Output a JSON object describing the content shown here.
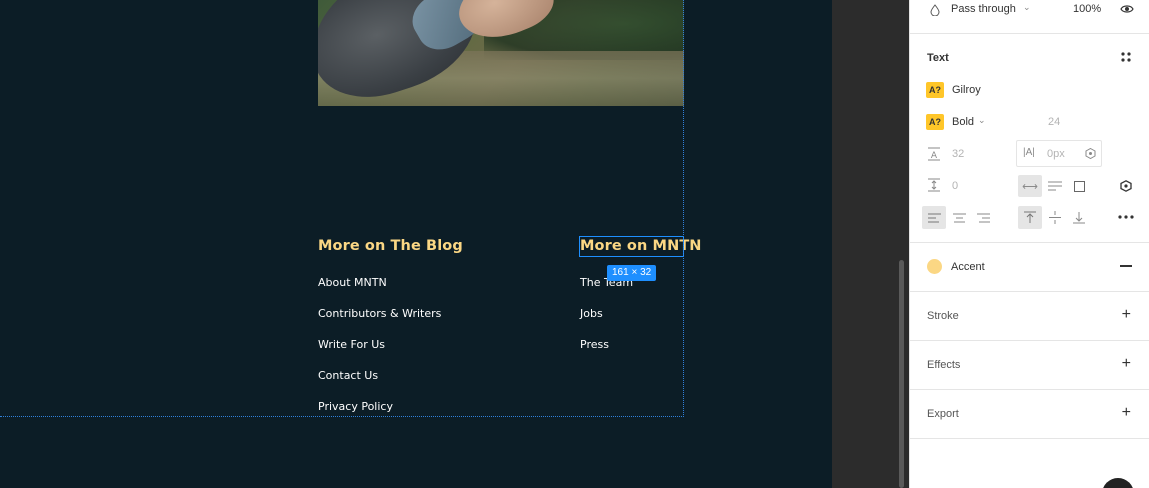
{
  "canvas": {
    "selection_size": "161 × 32",
    "blog_column": {
      "title": "More on The Blog",
      "links": [
        "About MNTN",
        "Contributors & Writers",
        "Write For Us",
        "Contact Us",
        "Privacy Policy"
      ]
    },
    "mntn_column": {
      "title": "More on MNTN",
      "links": [
        "The Team",
        "Jobs",
        "Press"
      ]
    },
    "colors": {
      "background": "#0c1d26",
      "accent": "#fbd784",
      "selection": "#1e8fff"
    }
  },
  "inspector": {
    "layer": {
      "blend_mode": "Pass through",
      "opacity": "100%"
    },
    "text": {
      "section_title": "Text",
      "font_family": "Gilroy",
      "font_weight": "Bold",
      "font_size": "24",
      "line_height": "32",
      "letter_spacing": "0px",
      "paragraph_spacing": "0",
      "style_chip": "A?"
    },
    "fill": {
      "style_name": "Accent",
      "color": "#fbd784"
    },
    "sections": {
      "stroke": "Stroke",
      "effects": "Effects",
      "export": "Export"
    }
  }
}
